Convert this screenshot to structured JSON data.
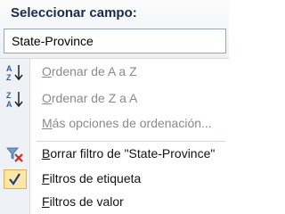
{
  "header": {
    "label": "Seleccionar campo:",
    "field_value": "State-Province"
  },
  "menu": {
    "sort_az": {
      "first": "O",
      "rest": "rdenar de A a Z",
      "icon": "sort-ascending-icon",
      "enabled": false
    },
    "sort_za": {
      "first": "O",
      "rest": "rdenar de Z a A",
      "icon": "sort-descending-icon",
      "enabled": false
    },
    "more_sort": {
      "first": "M",
      "rest": "ás opciones de ordenación...",
      "enabled": false
    },
    "clear_filter": {
      "first": "B",
      "rest": "orrar filtro de \"State-Province\"",
      "icon": "clear-filter-icon",
      "enabled": true
    },
    "label_filters": {
      "first": "F",
      "rest": "iltros de etiqueta",
      "icon": "checkmark-icon",
      "checked": true,
      "enabled": true
    },
    "value_filters": {
      "first": "F",
      "rest": "iltros de valor",
      "enabled": true
    }
  },
  "colors": {
    "header_text": "#1a2b4a",
    "check_highlight": "#fde7a6",
    "disabled_text": "#8a8a8a"
  }
}
